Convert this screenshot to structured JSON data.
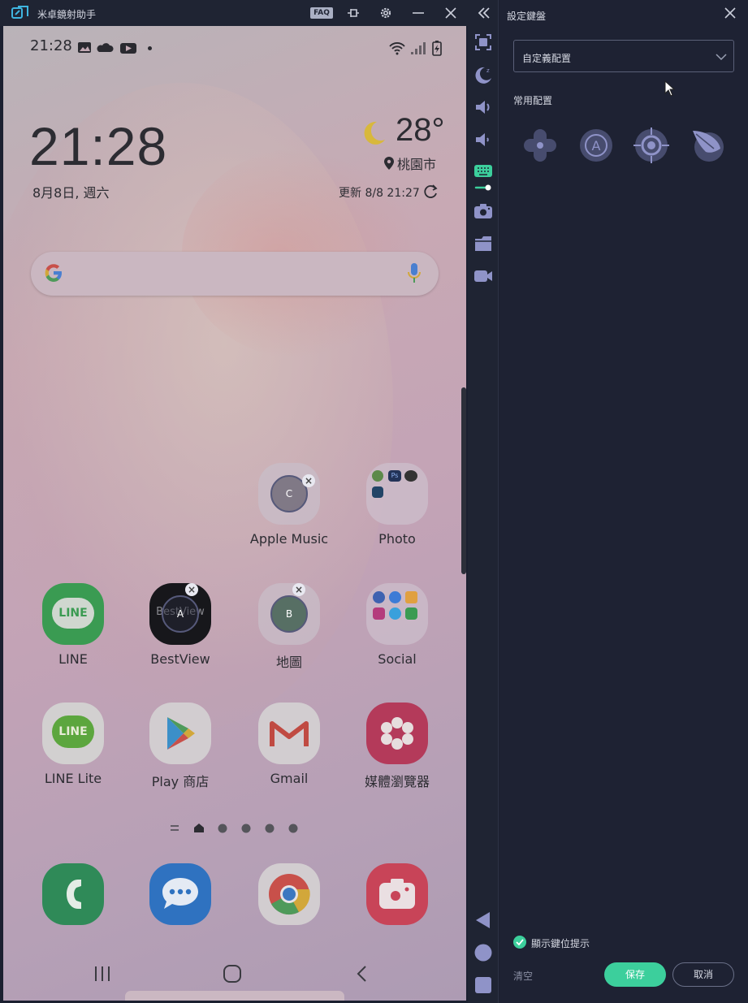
{
  "titlebar": {
    "title": "米卓鏡射助手",
    "faq_label": "FAQ"
  },
  "phone": {
    "status_time": "21:28",
    "clock": "21:28",
    "date": "8月8日, 週六",
    "temperature": "28°",
    "city": "桃園市",
    "update": "更新 8/8 21:27",
    "apps": [
      {
        "label": "Apple Music",
        "marker": "C"
      },
      {
        "label": "Photo"
      },
      {
        "label": "LINE",
        "icon_text": "LINE"
      },
      {
        "label": "BestView",
        "marker": "A",
        "icon_text": "BestView"
      },
      {
        "label": "地圖",
        "marker": "B"
      },
      {
        "label": "Social"
      },
      {
        "label": "LINE Lite",
        "icon_text": "LINE"
      },
      {
        "label": "Play 商店"
      },
      {
        "label": "Gmail"
      },
      {
        "label": "媒體瀏覽器"
      }
    ],
    "photo_folder_apps": [
      "Ps",
      "Px"
    ]
  },
  "panel": {
    "title": "設定鍵盤",
    "select_value": "自定義配置",
    "section_title": "常用配置",
    "presets": [
      "dpad-preset",
      "a-button-preset",
      "crosshair-preset",
      "skill-preset"
    ],
    "show_key_hint_label": "顯示鍵位提示",
    "show_key_hint_checked": true,
    "clear_label": "清空",
    "save_label": "保存",
    "cancel_label": "取消"
  },
  "colors": {
    "accent": "#3ccf9c",
    "panel_bg": "#1e2233",
    "strip_icon": "#8f93c8"
  }
}
